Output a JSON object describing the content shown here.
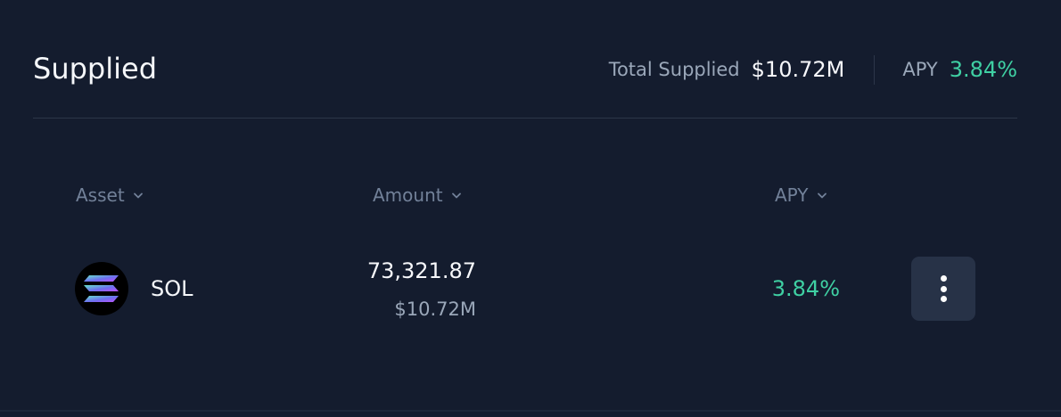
{
  "header": {
    "title": "Supplied",
    "total_supplied_label": "Total Supplied",
    "total_supplied_value": "$10.72M",
    "apy_label": "APY",
    "apy_value": "3.84%"
  },
  "table": {
    "columns": [
      {
        "label": "Asset",
        "icon": "chevron-down-icon"
      },
      {
        "label": "Amount",
        "icon": "chevron-down-icon"
      },
      {
        "label": "APY",
        "icon": "chevron-down-icon"
      }
    ],
    "rows": [
      {
        "symbol": "SOL",
        "icon": "solana-icon",
        "amount": "73,321.87",
        "amount_usd": "$10.72M",
        "apy": "3.84%",
        "action_icon": "more-vertical-icon"
      }
    ]
  },
  "colors": {
    "background": "#141c2e",
    "accent_green": "#3fd0a3",
    "muted_text": "#9aa7b9",
    "header_text": "#728199",
    "button_bg": "#273247"
  }
}
